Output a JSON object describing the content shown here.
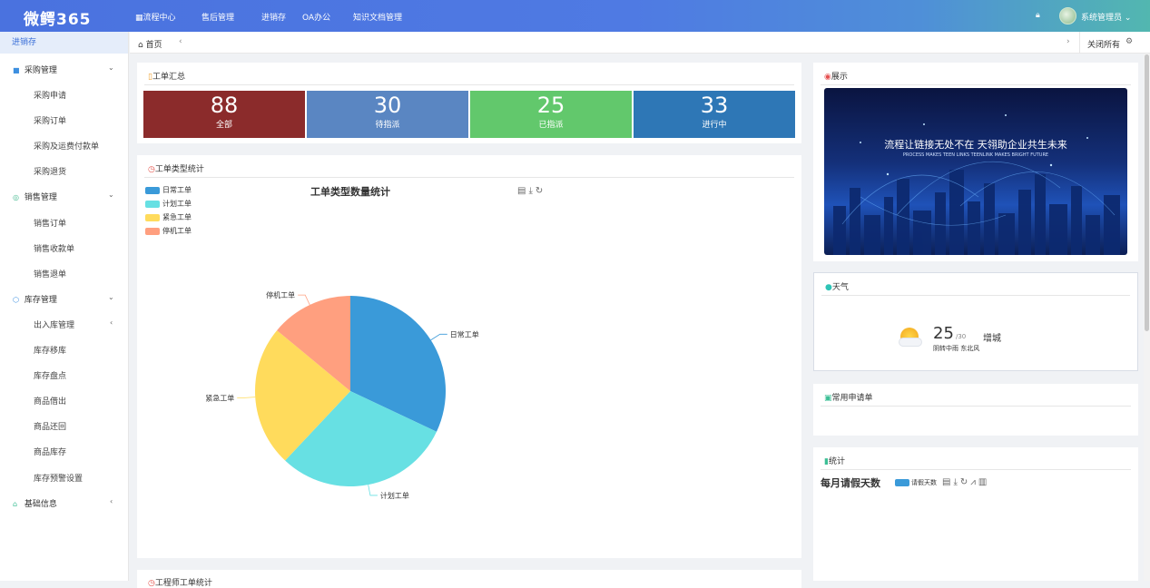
{
  "app": {
    "logo": "微鳄365",
    "user": "系统管理员"
  },
  "topnav": [
    {
      "label": "流程中心",
      "icon": "grid-icon"
    },
    {
      "label": "售后管理"
    },
    {
      "label": "进销存"
    },
    {
      "label": "OA办公"
    },
    {
      "label": "知识文档管理"
    }
  ],
  "sidebar": {
    "title": "进销存",
    "groups": [
      {
        "label": "采购管理",
        "items": [
          "采购申请",
          "采购订单",
          "采购及运费付款单",
          "采购退货"
        ]
      },
      {
        "label": "销售管理",
        "items": [
          "销售订单",
          "销售收款单",
          "销售退单"
        ]
      },
      {
        "label": "库存管理",
        "items": [
          "出入库管理",
          "库存移库",
          "库存盘点",
          "商品借出",
          "商品还回",
          "商品库存",
          "库存预警设置"
        ]
      },
      {
        "label": "基础信息",
        "items": []
      }
    ]
  },
  "tabs": {
    "home": "首页",
    "close_all": "关闭所有"
  },
  "summary": {
    "title": "工单汇总",
    "cards": [
      {
        "value": "88",
        "label": "全部",
        "color": "#8b2b2b"
      },
      {
        "value": "30",
        "label": "待指派",
        "color": "#5a86c2"
      },
      {
        "value": "25",
        "label": "已指派",
        "color": "#62c86c"
      },
      {
        "value": "33",
        "label": "进行中",
        "color": "#2e77b6"
      }
    ]
  },
  "type_stats": {
    "title": "工单类型统计",
    "chart_data": {
      "type": "pie",
      "title": "工单类型数量统计",
      "categories": [
        "日常工单",
        "计划工单",
        "紧急工单",
        "停机工单"
      ],
      "values": [
        32,
        30,
        24,
        14
      ],
      "colors": [
        "#3a9ad9",
        "#67e0e3",
        "#ffdb5c",
        "#ff9f7f"
      ]
    }
  },
  "next_panel": {
    "title": "工程师工单统计"
  },
  "showcase": {
    "title": "展示",
    "banner_title": "流程让链接无处不在 天翎助企业共生未来",
    "banner_sub": "PROCESS MAKES TEEN LINKS  TEENLINK MAKES BRIGHT FUTURE"
  },
  "weather": {
    "title": "天气",
    "temp": "25",
    "temp_high": "/30",
    "city": "增城",
    "desc": "阴转中雨 东北风"
  },
  "common": {
    "title": "常用申请单"
  },
  "stats": {
    "title": "统计",
    "chart_data": {
      "type": "bar",
      "title": "每月请假天数",
      "series": [
        {
          "name": "请假天数",
          "values": []
        }
      ]
    }
  }
}
